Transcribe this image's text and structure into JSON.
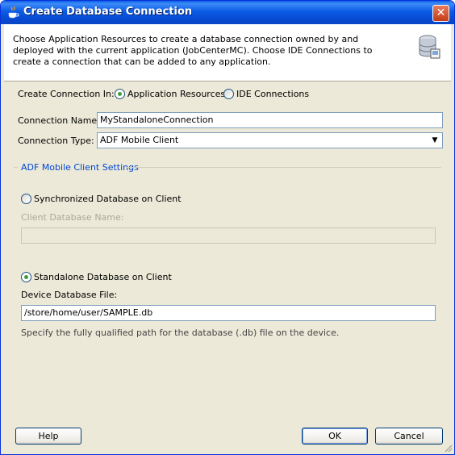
{
  "window": {
    "title": "Create Database Connection"
  },
  "header": {
    "description": "Choose Application Resources to create a database connection owned by and deployed with the current application (JobCenterMC). Choose IDE Connections to create a connection that can be added to any application."
  },
  "form": {
    "create_in_label": "Create Connection In:",
    "option_app_resources": "Application Resources",
    "option_ide_connections": "IDE Connections",
    "selected_location": "Application Resources",
    "connection_name_label": "Connection Name:",
    "connection_name_value": "MyStandaloneConnection",
    "connection_type_label": "Connection Type:",
    "connection_type_value": "ADF Mobile Client"
  },
  "settings": {
    "section_title": "ADF Mobile Client Settings",
    "option_synchronized": "Synchronized Database on Client",
    "client_db_name_label": "Client Database Name:",
    "client_db_name_value": "",
    "option_standalone": "Standalone Database on Client",
    "selected_db_option": "Standalone Database on Client",
    "device_db_file_label": "Device Database File:",
    "device_db_file_value": "/store/home/user/SAMPLE.db",
    "hint": "Specify the fully qualified path for the database (.db) file on the device."
  },
  "buttons": {
    "help": "Help",
    "ok": "OK",
    "cancel": "Cancel"
  },
  "icons": {
    "title_icon": "coffee-cup-icon",
    "header_icon": "database-icon",
    "close_icon": "close-icon",
    "dropdown_icon": "dropdown-arrow-icon"
  }
}
